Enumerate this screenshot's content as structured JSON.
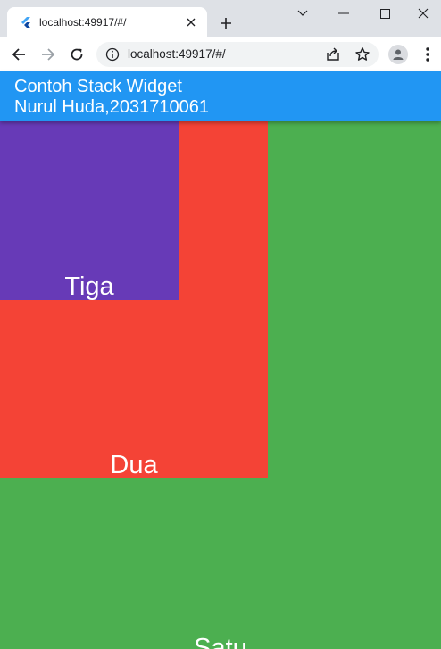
{
  "browser": {
    "tab_title": "localhost:49917/#/",
    "url": "localhost:49917/#/"
  },
  "app": {
    "title_line1": "Contoh Stack Widget",
    "title_line2": "Nurul Huda,2031710061",
    "title": "Contoh Stack Widget\nNurul Huda,2031710061",
    "appbar_color": "#2196f3"
  },
  "stack": {
    "satu": {
      "label": "Satu",
      "color": "#4caf50"
    },
    "dua": {
      "label": "Dua",
      "color": "#f44336"
    },
    "tiga": {
      "label": "Tiga",
      "color": "#673ab7"
    }
  }
}
